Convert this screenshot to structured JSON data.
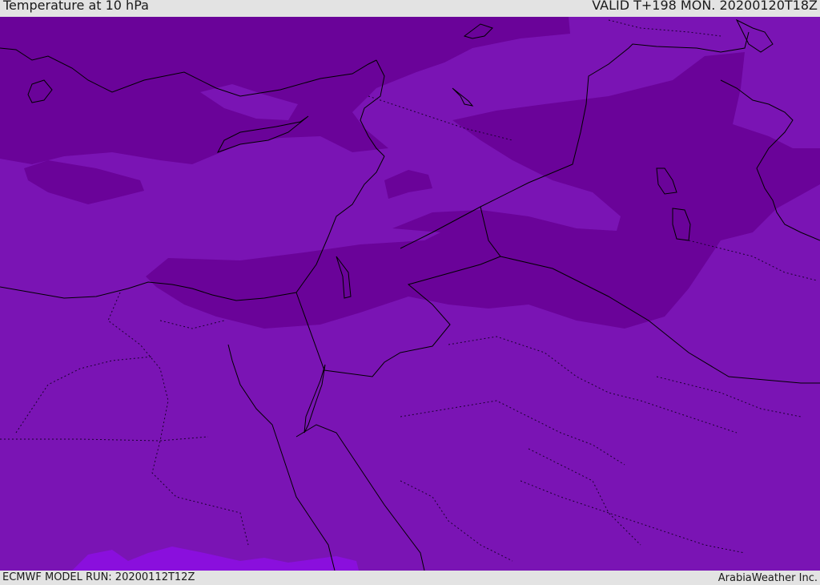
{
  "header": {
    "title": "Temperature at 10 hPa",
    "valid": "VALID T+198 MON. 20200120T18Z"
  },
  "footer": {
    "model_run": "ECMWF MODEL RUN: 20200112T12Z",
    "credit": "ArabiaWeather Inc."
  },
  "colors": {
    "band_light": "#7a14b4",
    "band_dark": "#6a0399",
    "band_warm": "#8a0fdd",
    "coastline": "#000000"
  }
}
